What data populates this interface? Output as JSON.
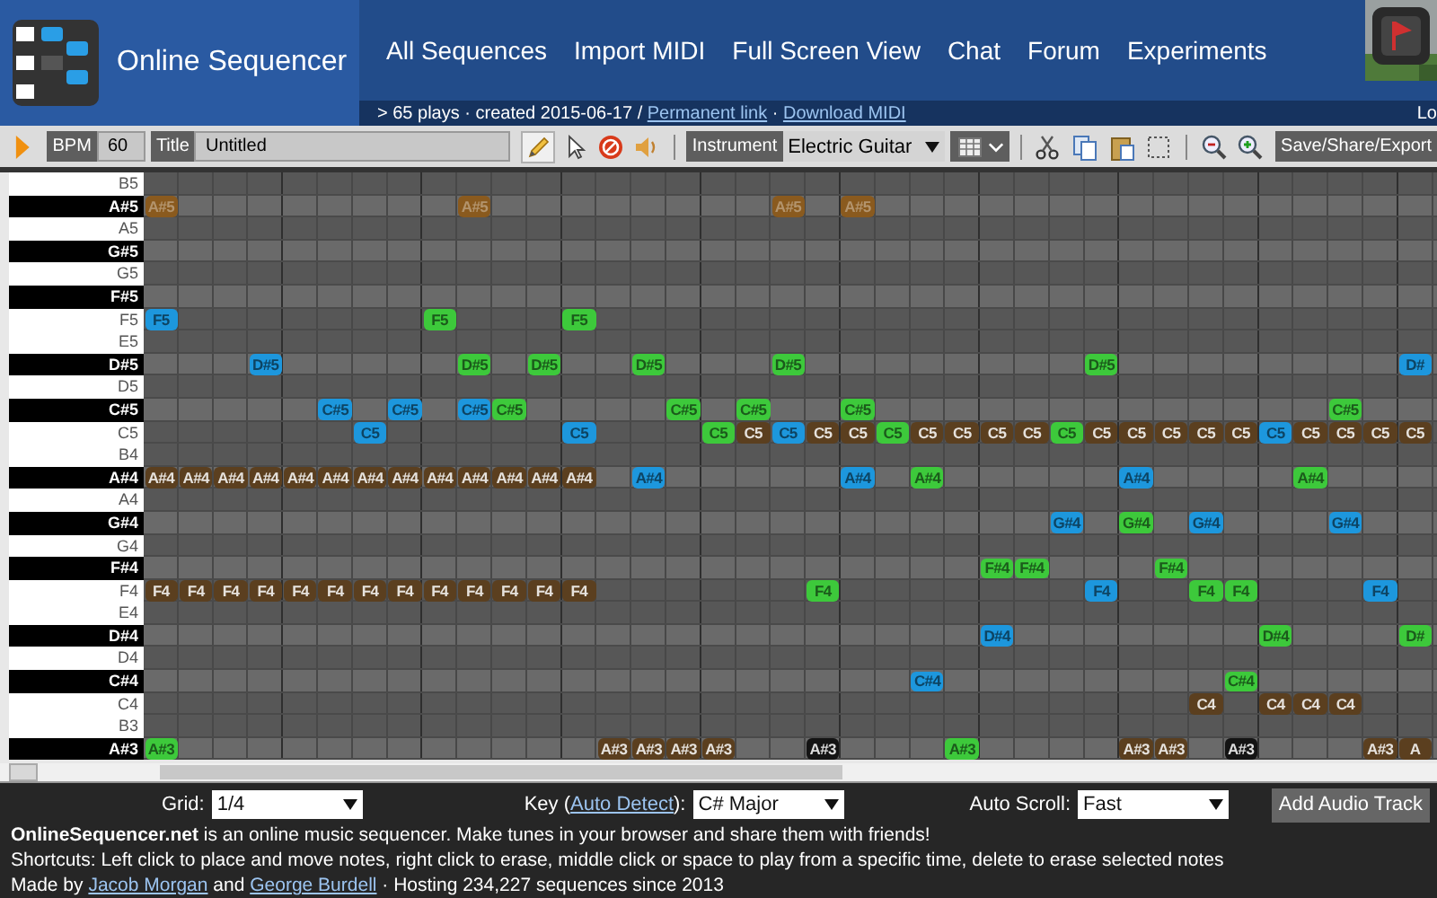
{
  "header": {
    "logo_text": "Online Sequencer",
    "nav": [
      "All Sequences",
      "Import MIDI",
      "Full Screen View",
      "Chat",
      "Forum",
      "Experiments"
    ],
    "avatar": {
      "kind": "picture"
    }
  },
  "info_bar": {
    "segments": [
      {
        "kind": "text",
        "text": "> 65 plays · created 2015-06-17 / "
      },
      {
        "kind": "link",
        "text": "Permanent link"
      },
      {
        "kind": "text",
        "text": " · "
      },
      {
        "kind": "link",
        "text": "Download MIDI"
      }
    ],
    "login": "Lo"
  },
  "toolbar": {
    "bpm_label": "BPM",
    "bpm": "60",
    "title_label": "Title",
    "title": "Untitled",
    "tools": [
      {
        "kind": "pencil",
        "selected": true
      },
      {
        "kind": "pointer",
        "selected": false
      },
      {
        "kind": "no-sign",
        "selected": false
      },
      {
        "kind": "speaker",
        "selected": false
      }
    ],
    "instrument_label": "Instrument",
    "instrument": "Electric Guitar",
    "edit_tools": [
      {
        "kind": "scissors"
      },
      {
        "kind": "copy"
      },
      {
        "kind": "paste"
      },
      {
        "kind": "select"
      }
    ],
    "zoom_tools": [
      {
        "kind": "zoom-out"
      },
      {
        "kind": "zoom-in"
      }
    ],
    "save": "Save/Share/Export"
  },
  "rows": [
    {
      "label": "B5",
      "kind": "white",
      "notes": []
    },
    {
      "label": "A#5",
      "kind": "black",
      "notes": [
        {
          "text": "A#5",
          "color": "#8a5a1e"
        },
        {
          "text": "A#5",
          "color": "#8a5a1e"
        },
        {
          "text": "A#5",
          "color": "#8a5a1e"
        },
        {
          "text": "A#5",
          "color": "#8a5a1e"
        }
      ]
    },
    {
      "label": "A5",
      "kind": "white",
      "notes": []
    },
    {
      "label": "G#5",
      "kind": "black",
      "notes": []
    },
    {
      "label": "G5",
      "kind": "white",
      "notes": []
    },
    {
      "label": "F#5",
      "kind": "black",
      "notes": []
    },
    {
      "label": "F5",
      "kind": "white",
      "notes": [
        {
          "text": "F5",
          "color": "#1d97dd"
        },
        {
          "text": "F5",
          "color": "#3dc93b"
        },
        {
          "text": "F5",
          "color": "#3dc93b"
        }
      ]
    },
    {
      "label": "E5",
      "kind": "white",
      "notes": []
    },
    {
      "label": "D#5",
      "kind": "black",
      "notes": [
        {
          "text": "D#5",
          "color": "#1d97dd"
        },
        {
          "text": "D#5",
          "color": "#3dc93b"
        },
        {
          "text": "D#5",
          "color": "#3dc93b"
        },
        {
          "text": "D#5",
          "color": "#3dc93b"
        },
        {
          "text": "D#5",
          "color": "#3dc93b"
        },
        {
          "text": "D#5",
          "color": "#3dc93b"
        },
        {
          "text": "D#",
          "color": "#1d97dd"
        }
      ]
    },
    {
      "label": "D5",
      "kind": "white",
      "notes": []
    },
    {
      "label": "C#5",
      "kind": "black",
      "notes": [
        {
          "text": "C#5",
          "color": "#1d97dd"
        },
        {
          "text": "C#5",
          "color": "#1d97dd"
        },
        {
          "text": "C#5",
          "color": "#1d97dd"
        },
        {
          "text": "C#5",
          "color": "#3dc93b"
        },
        {
          "text": "C#5",
          "color": "#3dc93b"
        },
        {
          "text": "C#5",
          "color": "#3dc93b"
        },
        {
          "text": "C#5",
          "color": "#3dc93b"
        },
        {
          "text": "C#5",
          "color": "#3dc93b"
        }
      ]
    },
    {
      "label": "C5",
      "kind": "white",
      "notes": [
        {
          "text": "C5",
          "color": "#1d97dd"
        },
        {
          "text": "C5",
          "color": "#1d97dd"
        },
        {
          "text": "C5",
          "color": "#3dc93b"
        },
        {
          "text": "C5",
          "color": "#5b3f1f"
        },
        {
          "text": "C5",
          "color": "#1d97dd"
        },
        {
          "text": "C5",
          "color": "#5b3f1f"
        },
        {
          "text": "C5",
          "color": "#5b3f1f"
        },
        {
          "text": "C5",
          "color": "#3dc93b"
        },
        {
          "text": "C5",
          "color": "#5b3f1f"
        },
        {
          "text": "C5",
          "color": "#5b3f1f"
        },
        {
          "text": "C5",
          "color": "#5b3f1f"
        },
        {
          "text": "C5",
          "color": "#5b3f1f"
        },
        {
          "text": "C5",
          "color": "#3dc93b"
        },
        {
          "text": "C5",
          "color": "#5b3f1f"
        },
        {
          "text": "C5",
          "color": "#5b3f1f"
        },
        {
          "text": "C5",
          "color": "#5b3f1f"
        },
        {
          "text": "C5",
          "color": "#5b3f1f"
        },
        {
          "text": "C5",
          "color": "#5b3f1f"
        },
        {
          "text": "C5",
          "color": "#1d97dd"
        },
        {
          "text": "C5",
          "color": "#5b3f1f"
        },
        {
          "text": "C5",
          "color": "#5b3f1f"
        },
        {
          "text": "C5",
          "color": "#5b3f1f"
        },
        {
          "text": "C5",
          "color": "#5b3f1f"
        }
      ]
    },
    {
      "label": "B4",
      "kind": "white",
      "notes": []
    },
    {
      "label": "A#4",
      "kind": "black",
      "notes": [
        {
          "text": "A#4",
          "color": "#5b3f1f"
        },
        {
          "text": "A#4",
          "color": "#5b3f1f"
        },
        {
          "text": "A#4",
          "color": "#5b3f1f"
        },
        {
          "text": "A#4",
          "color": "#5b3f1f"
        },
        {
          "text": "A#4",
          "color": "#5b3f1f"
        },
        {
          "text": "A#4",
          "color": "#5b3f1f"
        },
        {
          "text": "A#4",
          "color": "#5b3f1f"
        },
        {
          "text": "A#4",
          "color": "#5b3f1f"
        },
        {
          "text": "A#4",
          "color": "#5b3f1f"
        },
        {
          "text": "A#4",
          "color": "#5b3f1f"
        },
        {
          "text": "A#4",
          "color": "#5b3f1f"
        },
        {
          "text": "A#4",
          "color": "#5b3f1f"
        },
        {
          "text": "A#4",
          "color": "#5b3f1f"
        },
        {
          "text": "A#4",
          "color": "#1d97dd"
        },
        {
          "text": "A#4",
          "color": "#1d97dd"
        },
        {
          "text": "A#4",
          "color": "#3dc93b"
        },
        {
          "text": "A#4",
          "color": "#1d97dd"
        },
        {
          "text": "A#4",
          "color": "#3dc93b"
        }
      ]
    },
    {
      "label": "A4",
      "kind": "white",
      "notes": []
    },
    {
      "label": "G#4",
      "kind": "black",
      "notes": [
        {
          "text": "G#4",
          "color": "#1d97dd"
        },
        {
          "text": "G#4",
          "color": "#3dc93b"
        },
        {
          "text": "G#4",
          "color": "#1d97dd"
        },
        {
          "text": "G#4",
          "color": "#1d97dd"
        }
      ]
    },
    {
      "label": "G4",
      "kind": "white",
      "notes": []
    },
    {
      "label": "F#4",
      "kind": "black",
      "notes": [
        {
          "text": "F#4",
          "color": "#3dc93b"
        },
        {
          "text": "F#4",
          "color": "#3dc93b"
        },
        {
          "text": "F#4",
          "color": "#3dc93b"
        }
      ]
    },
    {
      "label": "F4",
      "kind": "white",
      "notes": [
        {
          "text": "F4",
          "color": "#5b3f1f"
        },
        {
          "text": "F4",
          "color": "#5b3f1f"
        },
        {
          "text": "F4",
          "color": "#5b3f1f"
        },
        {
          "text": "F4",
          "color": "#5b3f1f"
        },
        {
          "text": "F4",
          "color": "#5b3f1f"
        },
        {
          "text": "F4",
          "color": "#5b3f1f"
        },
        {
          "text": "F4",
          "color": "#5b3f1f"
        },
        {
          "text": "F4",
          "color": "#5b3f1f"
        },
        {
          "text": "F4",
          "color": "#5b3f1f"
        },
        {
          "text": "F4",
          "color": "#5b3f1f"
        },
        {
          "text": "F4",
          "color": "#5b3f1f"
        },
        {
          "text": "F4",
          "color": "#5b3f1f"
        },
        {
          "text": "F4",
          "color": "#5b3f1f"
        },
        {
          "text": "F4",
          "color": "#3dc93b"
        },
        {
          "text": "F4",
          "color": "#1d97dd"
        },
        {
          "text": "F4",
          "color": "#3dc93b"
        },
        {
          "text": "F4",
          "color": "#3dc93b"
        },
        {
          "text": "F4",
          "color": "#1d97dd"
        }
      ]
    },
    {
      "label": "E4",
      "kind": "white",
      "notes": []
    },
    {
      "label": "D#4",
      "kind": "black",
      "notes": [
        {
          "text": "D#4",
          "color": "#1d97dd"
        },
        {
          "text": "D#4",
          "color": "#3dc93b"
        },
        {
          "text": "D#",
          "color": "#3dc93b"
        }
      ]
    },
    {
      "label": "D4",
      "kind": "white",
      "notes": []
    },
    {
      "label": "C#4",
      "kind": "black",
      "notes": [
        {
          "text": "C#4",
          "color": "#1d97dd"
        },
        {
          "text": "C#4",
          "color": "#3dc93b"
        }
      ]
    },
    {
      "label": "C4",
      "kind": "white",
      "notes": [
        {
          "text": "C4",
          "color": "#5b3f1f"
        },
        {
          "text": "C4",
          "color": "#5b3f1f"
        },
        {
          "text": "C4",
          "color": "#5b3f1f"
        },
        {
          "text": "C4",
          "color": "#5b3f1f"
        }
      ]
    },
    {
      "label": "B3",
      "kind": "white",
      "notes": []
    },
    {
      "label": "A#3",
      "kind": "black",
      "notes": [
        {
          "text": "A#3",
          "color": "#3dc93b"
        },
        {
          "text": "A#3",
          "color": "#5b3f1f"
        },
        {
          "text": "A#3",
          "color": "#5b3f1f"
        },
        {
          "text": "A#3",
          "color": "#5b3f1f"
        },
        {
          "text": "A#3",
          "color": "#5b3f1f"
        },
        {
          "text": "A#3",
          "color": "#141414"
        },
        {
          "text": "A#3",
          "color": "#3dc93b"
        },
        {
          "text": "A#3",
          "color": "#5b3f1f"
        },
        {
          "text": "A#3",
          "color": "#5b3f1f"
        },
        {
          "text": "A#3",
          "color": "#141414"
        },
        {
          "text": "A#3",
          "color": "#5b3f1f"
        },
        {
          "text": "A",
          "color": "#5b3f1f"
        }
      ]
    }
  ],
  "options": {
    "grid_label": "Grid:",
    "grid": "1/4",
    "key_segments": [
      {
        "kind": "text",
        "text": "Key ("
      },
      {
        "kind": "link",
        "text": "Auto Detect"
      },
      {
        "kind": "text",
        "text": "):"
      }
    ],
    "key": "C# Major",
    "scroll_label": "Auto Scroll:",
    "scroll": "Fast",
    "add_track": "Add Audio Track"
  },
  "footer": [
    [
      {
        "kind": "bold",
        "text": "OnlineSequencer.net"
      },
      {
        "kind": "text",
        "text": " is an online music sequencer. Make tunes in your browser and share them with friends!"
      }
    ],
    [
      {
        "kind": "text",
        "text": "Shortcuts: Left click to place and move notes, right click to erase, middle click or space to play from a specific time, delete to erase selected notes"
      }
    ],
    [
      {
        "kind": "text",
        "text": "Made by "
      },
      {
        "kind": "link",
        "text": "Jacob Morgan"
      },
      {
        "kind": "text",
        "text": " and "
      },
      {
        "kind": "link",
        "text": "George Burdell"
      },
      {
        "kind": "text",
        "text": " · Hosting 234,227 sequences since 2013"
      }
    ]
  ]
}
